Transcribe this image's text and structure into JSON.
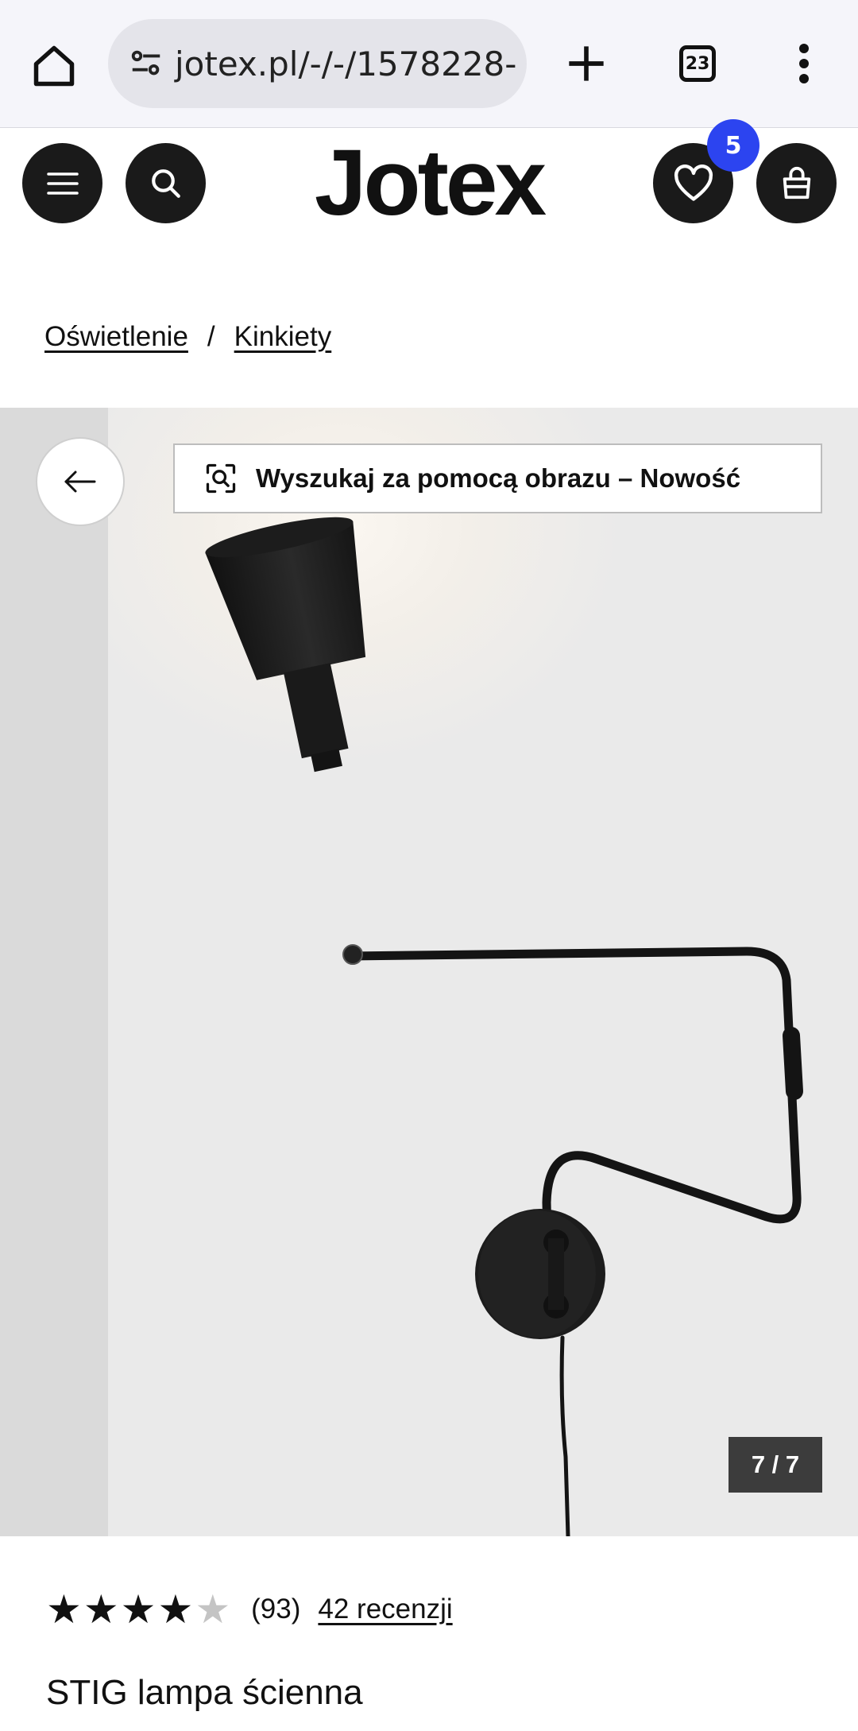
{
  "browser": {
    "url": "jotex.pl/-/-/1578228-",
    "tab_count": "23"
  },
  "header": {
    "logo": "Jotex",
    "wishlist_count": "5"
  },
  "breadcrumb": {
    "items": [
      "Oświetlenie",
      "Kinkiety"
    ],
    "separator": "/"
  },
  "gallery": {
    "visual_search_label": "Wyszukaj za pomocą obrazu – Nowość",
    "counter": "7 / 7"
  },
  "product": {
    "rating": 4,
    "rating_max": 5,
    "rating_count": "(93)",
    "reviews_link": "42 recenzji",
    "title": "STIG lampa ścienna"
  },
  "colors": {
    "accent_badge": "#2c44f0",
    "header_buttons": "#1a1a1a"
  }
}
